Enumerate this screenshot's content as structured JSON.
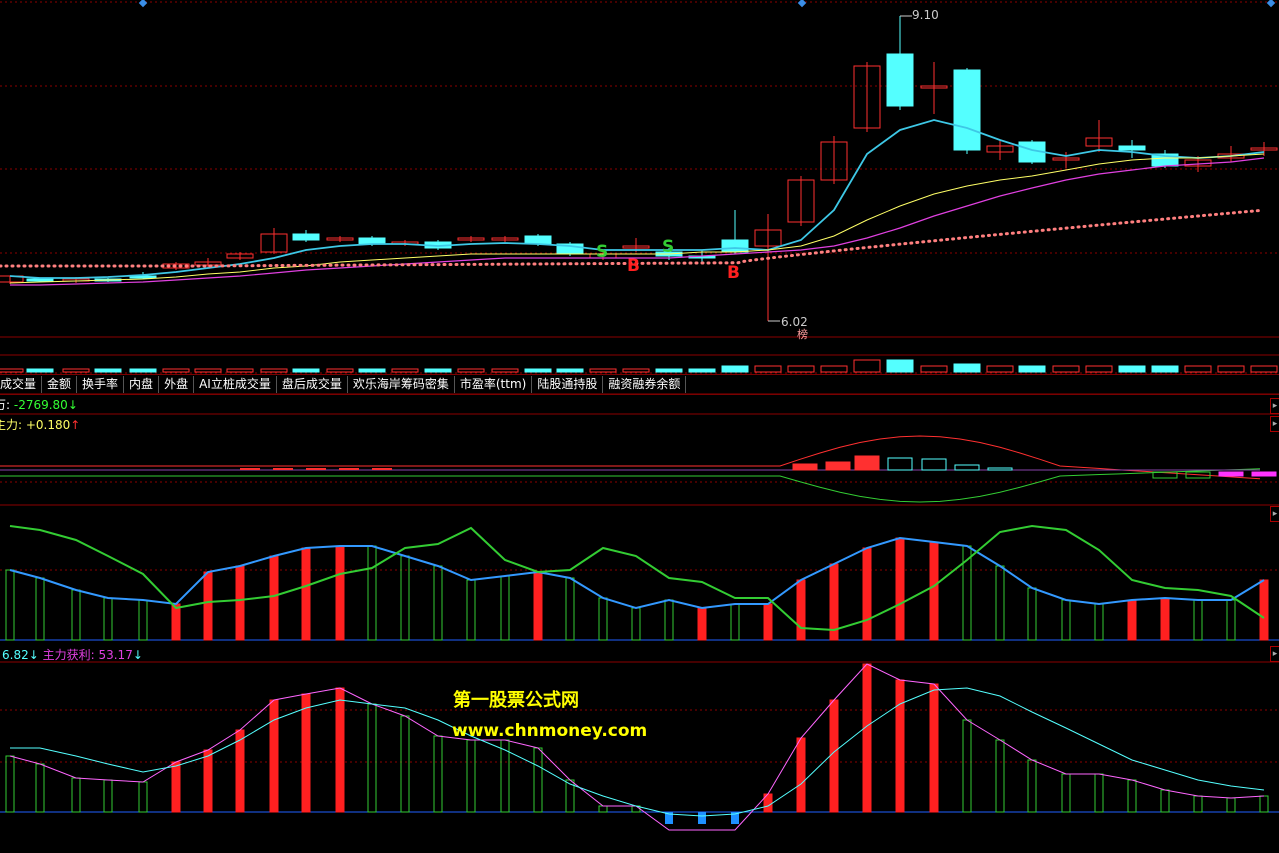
{
  "price_panel": {
    "high_label": "9.10",
    "low_label": "6.02",
    "bang_label": "榜",
    "signals": [
      {
        "text": "S",
        "color": "#33cc33"
      },
      {
        "text": "B",
        "color": "#ff2020"
      },
      {
        "text": "S",
        "color": "#33cc33"
      },
      {
        "text": "B",
        "color": "#ff2020"
      }
    ]
  },
  "tabs": [
    {
      "label": "成交量"
    },
    {
      "label": "金额"
    },
    {
      "label": "换手率"
    },
    {
      "label": "内盘"
    },
    {
      "label": "外盘"
    },
    {
      "label": "AI立桩成交量"
    },
    {
      "label": "盘后成交量"
    },
    {
      "label": "欢乐海岸筹码密集"
    },
    {
      "label": "市盈率(ttm)"
    },
    {
      "label": "陆股通持股"
    },
    {
      "label": "融资融券余额"
    }
  ],
  "indicator1": {
    "line1_prefix": "万: ",
    "line1_value": "-2769.80",
    "line1_arrow": "↓",
    "line2_prefix": "主力: ",
    "line2_value": "+0.180",
    "line2_arrow": "↑"
  },
  "indicator3": {
    "value1": "6.82",
    "arrow1": "↓",
    "label2": "主力获利: ",
    "value2": "53.17",
    "arrow2": "↓"
  },
  "watermark": {
    "line1": "第一股票公式网",
    "line2": "www.chnmoney.com"
  },
  "colors": {
    "up": "#ff3030",
    "down": "#54ffff",
    "ma_short": "#3ec8e6",
    "ma_mid": "#ffff66",
    "ma_long": "#e040e0",
    "dotted": "#ff7f7f",
    "grid": "#8b0000"
  }
}
